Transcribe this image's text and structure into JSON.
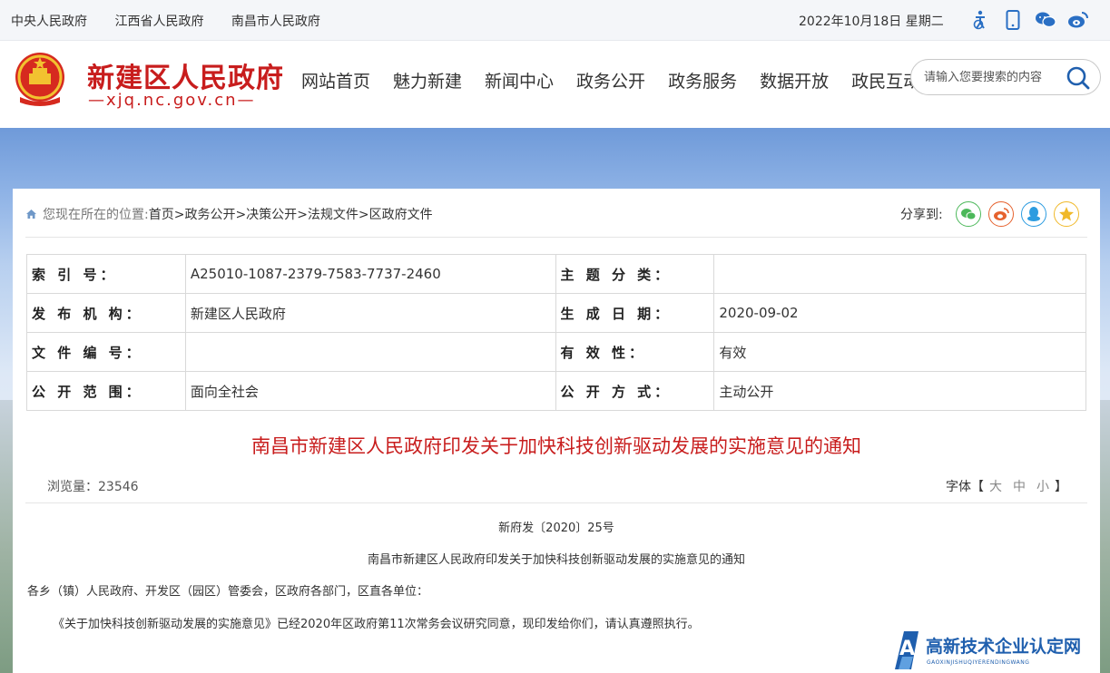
{
  "topbar": {
    "links": [
      "中央人民政府",
      "江西省人民政府",
      "南昌市人民政府"
    ],
    "date": "2022年10月18日 星期二"
  },
  "header": {
    "site_name": "新建区人民政府",
    "site_url": "—xjq.nc.gov.cn—",
    "nav": [
      "网站首页",
      "魅力新建",
      "新闻中心",
      "政务公开",
      "政务服务",
      "数据开放",
      "政民互动"
    ],
    "search_placeholder": "请输入您要搜索的内容"
  },
  "breadcrumb": {
    "prefix": "您现在所在的位置:",
    "items": [
      "首页",
      ">政务公开",
      ">决策公开",
      ">法规文件",
      ">区政府文件"
    ]
  },
  "share": {
    "label": "分享到:"
  },
  "meta": {
    "rows": [
      [
        "索 引 号：",
        "A25010-1087-2379-7583-7737-2460",
        "主 题 分 类：",
        ""
      ],
      [
        "发 布 机 构：",
        "新建区人民政府",
        "生 成 日 期：",
        "2020-09-02"
      ],
      [
        "文 件 编 号：",
        "",
        "有 效 性：",
        "有效"
      ],
      [
        "公 开 范 围：",
        "面向全社会",
        "公 开 方 式：",
        "主动公开"
      ]
    ]
  },
  "article": {
    "title": "南昌市新建区人民政府印发关于加快科技创新驱动发展的实施意见的通知",
    "views_label": "浏览量：",
    "views": "23546",
    "font_label": "字体【",
    "font_opts": [
      "大",
      "中",
      "小"
    ],
    "font_end": "】",
    "doc_no": "新府发〔2020〕25号",
    "subtitle": "南昌市新建区人民政府印发关于加快科技创新驱动发展的实施意见的通知",
    "p1": "各乡（镇）人民政府、开发区（园区）管委会，区政府各部门，区直各单位：",
    "p2": "《关于加快科技创新驱动发展的实施意见》已经2020年区政府第11次常务会议研究同意，现印发给你们，请认真遵照执行。"
  },
  "watermark": {
    "title": "高新技术企业认定网",
    "sub": "GAOXINJISHUQIYERENDINGWANG"
  },
  "colors": {
    "brand_red": "#c81d1d",
    "watermark_blue": "#1f5fae"
  }
}
